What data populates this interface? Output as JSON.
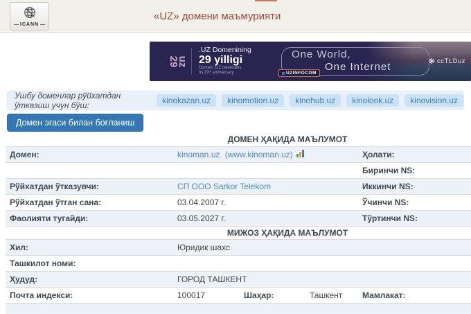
{
  "header": {
    "title": "«UZ» домени маъмурияти",
    "icann_label": "ICANN"
  },
  "banner": {
    "logo_line1": "uz",
    "logo_line2": "29",
    "title_line1": ".UZ Domenining",
    "title_line2": "29 yilligi",
    "subtitle_line1": "Domain .UZ celebrates",
    "subtitle_line2": "its 29ᵗʰ anniversary",
    "uzinfocom_label": "UZINFOCOM",
    "slogan_line1": "One World,",
    "slogan_line2": "One Internet",
    "cctld_label": "ccTLDuz",
    "bg_color": "#2a2550",
    "accent_pink": "#c8a3c6"
  },
  "available": {
    "label": "Ушбу доменлар рўйхатдан ўтказиш учун бўш:",
    "domains": [
      "kinokazan.uz",
      "kinomotion.uz",
      "kinohub.uz",
      "kinolook.uz",
      "kinovision.uz"
    ]
  },
  "actions": {
    "contact_owner": "Домен эгаси билан боғланиш"
  },
  "domain_table": {
    "section_title": "ДОМЕН ҲАҚИДА МАЪЛУМОТ",
    "rows": {
      "domain": {
        "label": "Домен:",
        "link": "kinoman.uz",
        "link_extra": "(www.kinoman.uz)",
        "right_label": "Ҳолати:",
        "right_value": ""
      },
      "ns1": {
        "label": "",
        "value": "",
        "right_label": "Биринчи NS:",
        "right_value": ""
      },
      "registrar": {
        "label": "Рўйхатдан ўтказувчи:",
        "link": "СП ООО Sarkor Telekom",
        "right_label": "Иккинчи NS:",
        "right_value": ""
      },
      "registered": {
        "label": "Рўйхатдан ўтган сана:",
        "value": "03.04.2007 г.",
        "right_label": "Ўчинчи NS:",
        "right_value": ""
      },
      "expires": {
        "label": "Фаолияти тугайди:",
        "value": "03.05.2027 г.",
        "right_label": "Тўртинчи NS:",
        "right_value": ""
      }
    }
  },
  "client_table": {
    "section_title": "МИЖОЗ ҲАҚИДА МАЪЛУМОТ",
    "rows": {
      "type": {
        "label": "Хил:",
        "value": "Юридик шахс"
      },
      "org": {
        "label": "Ташкилот номи:",
        "value": ""
      },
      "region": {
        "label": "Ҳудуд:",
        "value": "ГОРОД ТАШКЕНТ"
      },
      "postal": {
        "label": "Почта индекси:",
        "value": "100017",
        "city_label": "Шаҳар:",
        "city_value": "Ташкент",
        "country_label": "Мамлакат:",
        "country_value": ""
      }
    }
  }
}
